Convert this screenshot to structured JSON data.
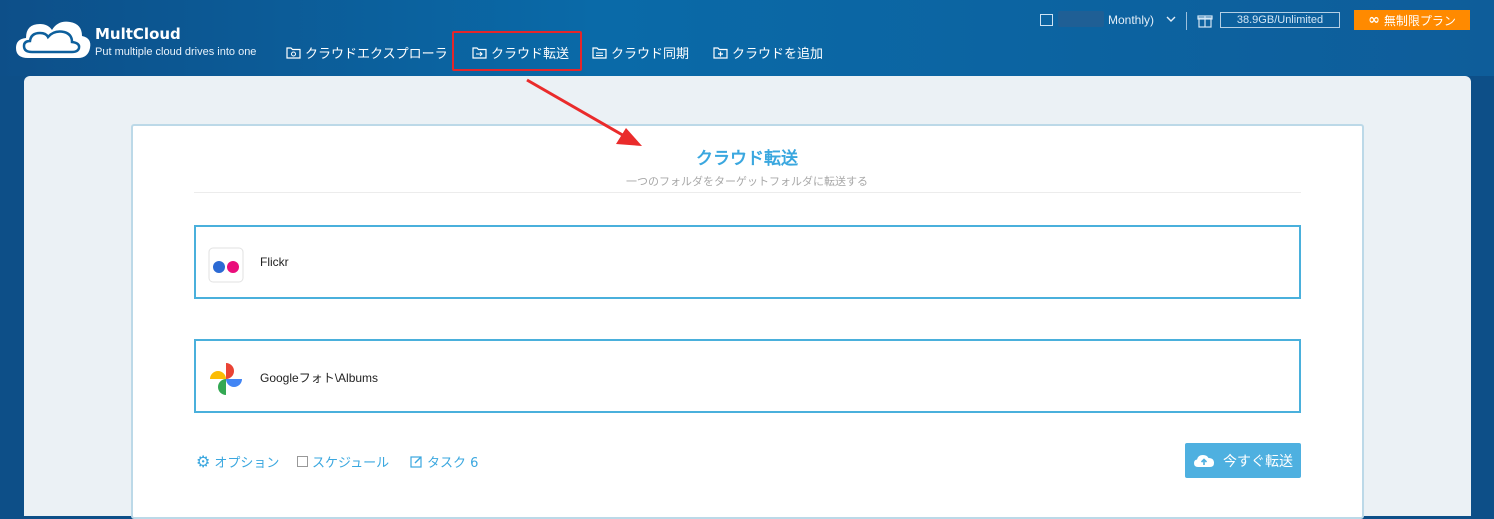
{
  "header": {
    "brand": "MultCloud",
    "tagline": "Put multiple cloud drives into one",
    "plan_text": "Monthly)",
    "storage": "38.9GB/Unlimited",
    "unlimited_label": "無制限プラン"
  },
  "nav": {
    "items": [
      {
        "label": "クラウドエクスプローラ",
        "icon": "gear-folder-icon"
      },
      {
        "label": "クラウド転送",
        "icon": "transfer-folder-icon"
      },
      {
        "label": "クラウド同期",
        "icon": "sync-folder-icon"
      },
      {
        "label": "クラウドを追加",
        "icon": "add-folder-icon"
      }
    ]
  },
  "page": {
    "title": "クラウド転送",
    "subtitle": "一つのフォルダをターゲットフォルダに転送する"
  },
  "source": {
    "label": "Flickr",
    "icon": "flickr-icon"
  },
  "target": {
    "label": "Googleフォト\\Albums",
    "icon": "google-photos-icon"
  },
  "options": {
    "option_label": "オプション",
    "schedule_label": "スケジュール",
    "task_label": "タスク 6"
  },
  "action": {
    "transfer_now_label": "今すぐ転送"
  },
  "colors": {
    "accent": "#3aa7df",
    "highlight": "#e5262a",
    "orange": "#ff8a00",
    "header": "#0a6aa8"
  }
}
